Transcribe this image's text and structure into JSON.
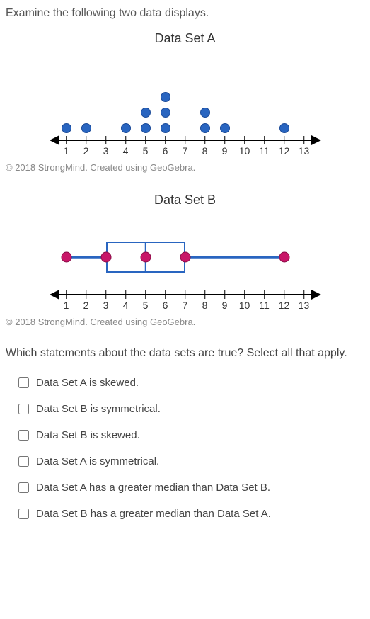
{
  "instruction": "Examine the following two data displays.",
  "copyright": "© 2018 StrongMind. Created using GeoGebra.",
  "question": "Which statements about the data sets are true? Select all that apply.",
  "chartA": {
    "title": "Data Set A",
    "ticks": [
      1,
      2,
      3,
      4,
      5,
      6,
      7,
      8,
      9,
      10,
      11,
      12,
      13
    ]
  },
  "chartB": {
    "title": "Data Set B",
    "ticks": [
      1,
      2,
      3,
      4,
      5,
      6,
      7,
      8,
      9,
      10,
      11,
      12,
      13
    ]
  },
  "options": [
    "Data Set A is skewed.",
    "Data Set B is symmetrical.",
    "Data Set B is skewed.",
    "Data Set A is symmetrical.",
    "Data Set A has a greater median than Data Set B.",
    "Data Set B has a greater median than Data Set A."
  ],
  "chart_data": [
    {
      "type": "dotplot",
      "title": "Data Set A",
      "x": [
        1,
        2,
        4,
        5,
        5,
        6,
        6,
        6,
        8,
        8,
        9,
        12
      ],
      "xlabel": "",
      "xlim": [
        1,
        13
      ]
    },
    {
      "type": "boxplot",
      "title": "Data Set B",
      "min": 1,
      "q1": 3,
      "median": 5,
      "q3": 7,
      "max": 12,
      "xlabel": "",
      "xlim": [
        1,
        13
      ]
    }
  ]
}
